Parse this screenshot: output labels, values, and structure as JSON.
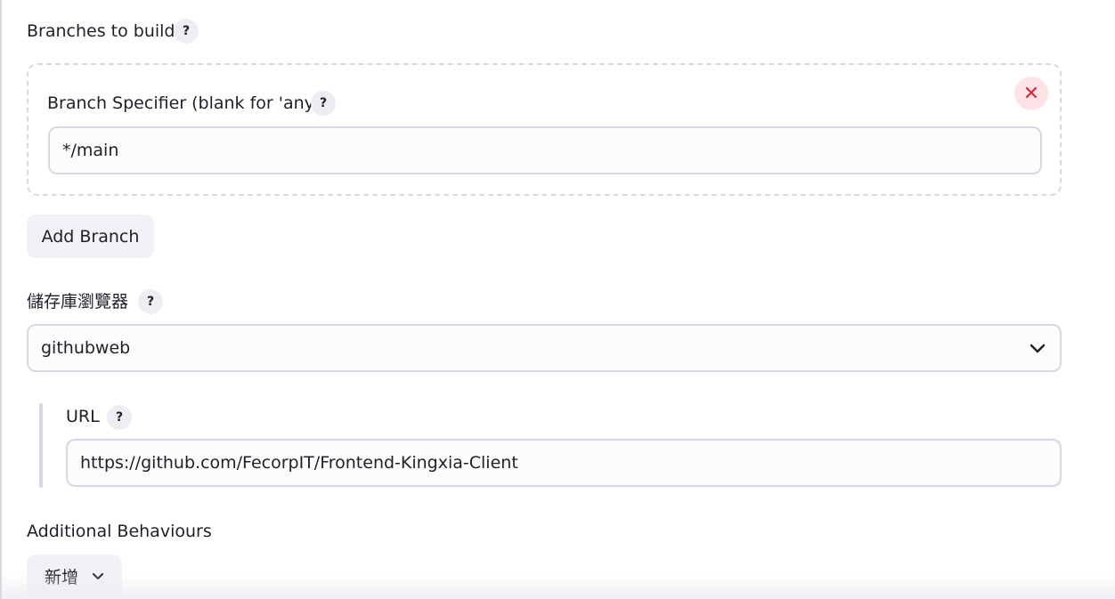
{
  "branches": {
    "section_label": "Branches to build",
    "help_icon": "?",
    "specifier_label": "Branch Specifier (blank for 'any')",
    "specifier_value": "*/main",
    "remove_icon": "✕",
    "add_branch_label": "Add Branch"
  },
  "repo_browser": {
    "label": "儲存庫瀏覽器",
    "selected": "githubweb",
    "url_label": "URL",
    "url_value": "https://github.com/FecorpIT/Frontend-Kingxia-Client"
  },
  "additional": {
    "label": "Additional Behaviours",
    "add_button_label": "新增"
  },
  "colors": {
    "border": "#d6d8e4",
    "danger": "#e0253b",
    "danger_bg": "#fbe3e6",
    "button_bg": "#f1f2f5"
  }
}
